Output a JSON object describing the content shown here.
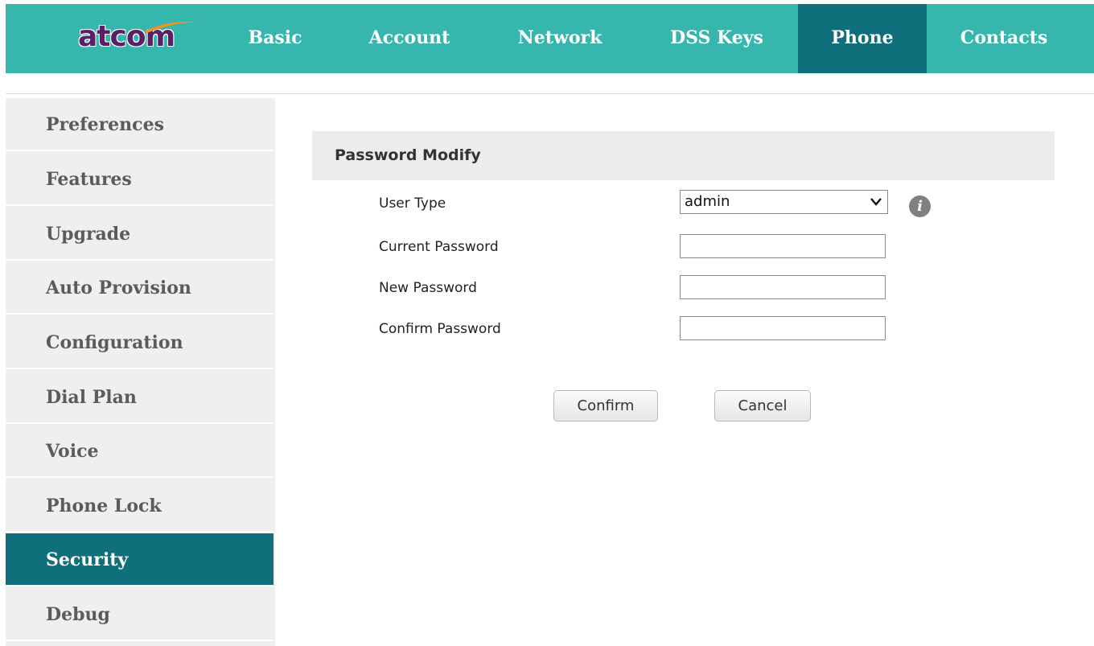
{
  "brand": {
    "logo_text": "atcom"
  },
  "nav": {
    "tabs": [
      {
        "label": "Basic"
      },
      {
        "label": "Account"
      },
      {
        "label": "Network"
      },
      {
        "label": "DSS Keys"
      },
      {
        "label": "Phone",
        "active": true
      },
      {
        "label": "Contacts"
      }
    ]
  },
  "sidebar": {
    "items": [
      {
        "label": "Preferences"
      },
      {
        "label": "Features"
      },
      {
        "label": "Upgrade"
      },
      {
        "label": "Auto Provision"
      },
      {
        "label": "Configuration"
      },
      {
        "label": "Dial Plan"
      },
      {
        "label": "Voice"
      },
      {
        "label": "Phone Lock"
      },
      {
        "label": "Security",
        "active": true
      },
      {
        "label": "Debug"
      }
    ]
  },
  "form": {
    "title": "Password Modify",
    "user_type_label": "User Type",
    "user_type_value": "admin",
    "current_password_label": "Current Password",
    "current_password_value": "",
    "new_password_label": "New Password",
    "new_password_value": "",
    "confirm_password_label": "Confirm Password",
    "confirm_password_value": "",
    "info_icon": "info-icon",
    "confirm_button": "Confirm",
    "cancel_button": "Cancel"
  },
  "colors": {
    "header_bg": "#36b6ac",
    "active_bg": "#0f6f7b",
    "sidebar_bg": "#efefef",
    "logo": "#5a1f66",
    "logo_swoosh": "#f0922a"
  }
}
